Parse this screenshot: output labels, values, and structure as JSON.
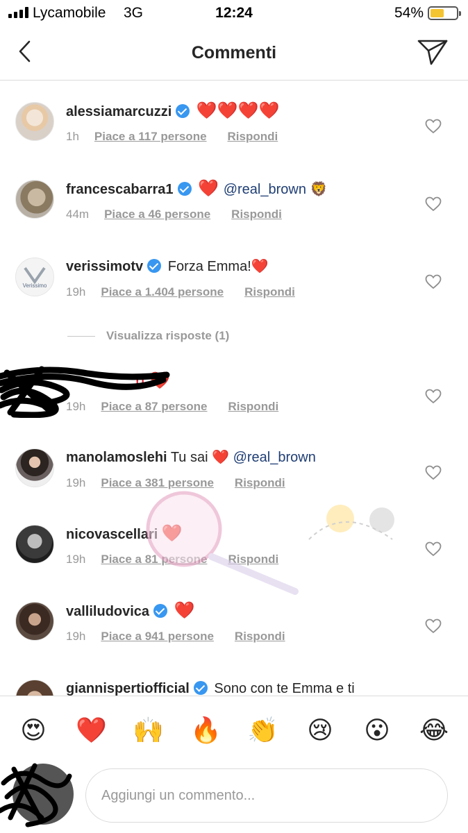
{
  "status_bar": {
    "carrier": "Lycamobile",
    "network": "3G",
    "time": "12:24",
    "battery_percent": "54%",
    "battery_level": 0.54
  },
  "header": {
    "title": "Commenti",
    "back_icon": "chevron-left-icon",
    "send_icon": "paper-plane-icon"
  },
  "comments": [
    {
      "username": "alessiamarcuzzi",
      "verified": true,
      "text": "❤️❤️❤️❤️",
      "time": "1h",
      "likes": "Piace a 117 persone",
      "reply": "Rispondi"
    },
    {
      "username": "francescabarra1",
      "verified": true,
      "text_before": "❤️ ",
      "mention": "@real_brown",
      "text_after": " 🦁",
      "time": "44m",
      "likes": "Piace a 46 persone",
      "reply": "Rispondi"
    },
    {
      "username": "verissimotv",
      "verified": true,
      "text": "Forza Emma!❤️",
      "time": "19h",
      "likes": "Piace a 1.404 persone",
      "reply": "Rispondi"
    },
    {
      "username": "",
      "verified": false,
      "text": "ri ❤️",
      "time": "19h",
      "likes": "Piace a 87 persone",
      "reply": "Rispondi"
    },
    {
      "username": "manolamoslehi",
      "verified": false,
      "text_before": "Tu sai ❤️ ",
      "mention": "@real_brown",
      "text_after": "",
      "time": "19h",
      "likes": "Piace a 381 persone",
      "reply": "Rispondi"
    },
    {
      "username": "nicovascellari",
      "verified": false,
      "text": "❤️",
      "time": "19h",
      "likes": "Piace a 81 persone",
      "reply": "Rispondi"
    },
    {
      "username": "valliludovica",
      "verified": true,
      "text": "❤️",
      "time": "19h",
      "likes": "Piace a 941 persone",
      "reply": "Rispondi"
    },
    {
      "username": "giannispertiofficial",
      "verified": true,
      "text": "Sono con te Emma e ti"
    }
  ],
  "view_replies": "Visualizza risposte (1)",
  "verissimo_logo_text": "Verissimo",
  "emoji_bar": [
    "😍",
    "❤️",
    "🙌",
    "🔥",
    "👏",
    "😢",
    "😮",
    "😂"
  ],
  "comment_input": {
    "placeholder": "Aggiungi un commento..."
  },
  "colors": {
    "verified": "#3897f0",
    "heart": "#e0192a",
    "mention": "#1f3e74",
    "meta": "#999999",
    "battery": "#f5c431"
  }
}
